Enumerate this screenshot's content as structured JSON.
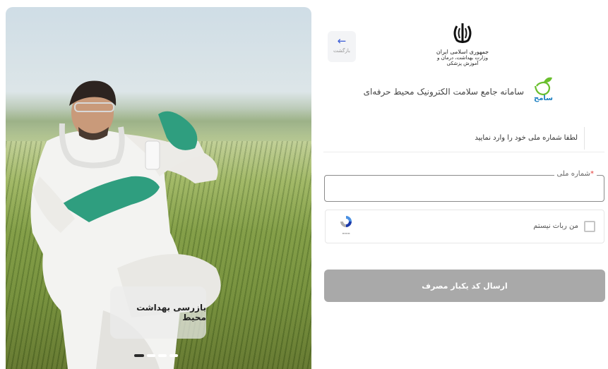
{
  "hero": {
    "caption": "بازرسی بهداشت محیط",
    "slides_total": 4,
    "active_slide": 1
  },
  "back_button": {
    "label": "بازگشت"
  },
  "emblem": {
    "line1": "جمهوری اسلامی ایران",
    "line2": "وزارت بهداشت، درمان و آموزش پزشکی"
  },
  "brand": {
    "logo_text": "سامح",
    "title": "سامانه جامع سلامت الکترونیک محیط حرفه‌ای"
  },
  "tab": {
    "label": "لطفا شماره ملی خود را وارد نمایید"
  },
  "national_id": {
    "label": "شماره ملی",
    "required_mark": "*",
    "value": ""
  },
  "captcha": {
    "label": "من ربات نیستم",
    "checked": false
  },
  "submit": {
    "label": "ارسال کد یکبار مصرف",
    "enabled": false
  },
  "colors": {
    "accent": "#3a5bd6",
    "submit_disabled": "#a9a9a9",
    "required": "#e53935",
    "logo_green": "#6abf2e",
    "logo_blue": "#1a7fc1"
  }
}
